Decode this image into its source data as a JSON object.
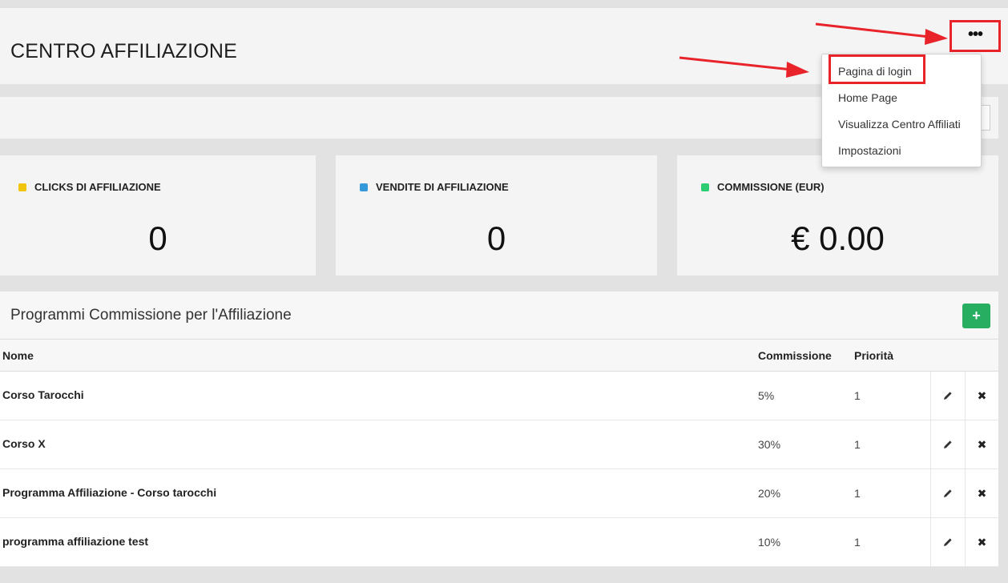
{
  "header": {
    "title": "CENTRO AFFILIAZIONE",
    "more_label": "•••"
  },
  "dropdown": {
    "items": [
      "Pagina di login",
      "Home Page",
      "Visualizza Centro Affiliati",
      "Impostazioni"
    ]
  },
  "stats": [
    {
      "label": "CLICKS DI AFFILIAZIONE",
      "value": "0",
      "color": "#f1c40f"
    },
    {
      "label": "VENDITE DI AFFILIAZIONE",
      "value": "0",
      "color": "#3498db"
    },
    {
      "label": "COMMISSIONE (EUR)",
      "value": "€ 0.00",
      "color": "#2ecc71"
    }
  ],
  "programs": {
    "title": "Programmi Commissione per l'Affiliazione",
    "add_label": "+",
    "columns": {
      "name": "Nome",
      "commission": "Commissione",
      "priority": "Priorità"
    },
    "rows": [
      {
        "name": "Corso Tarocchi",
        "commission": "5%",
        "priority": "1"
      },
      {
        "name": "Corso X",
        "commission": "30%",
        "priority": "1"
      },
      {
        "name": "Programma Affiliazione - Corso tarocchi",
        "commission": "20%",
        "priority": "1"
      },
      {
        "name": "programma affiliazione test",
        "commission": "10%",
        "priority": "1"
      }
    ]
  },
  "colors": {
    "accent_red": "#e8232a",
    "add_green": "#27ae60"
  }
}
